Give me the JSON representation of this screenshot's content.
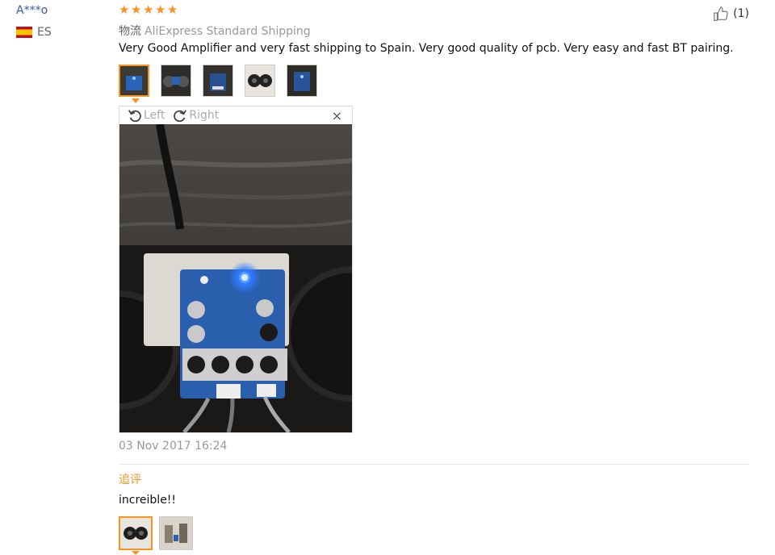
{
  "reviewer": {
    "name": "A***o",
    "country": "ES"
  },
  "review": {
    "rating": 5,
    "helpful_count": "(1)",
    "logistics_label": "物流",
    "logistics_value": "AliExpress Standard Shipping",
    "text": "Very Good Amplifier and very fast shipping to Spain. Very good quality of pcb. Very easy and fast BT pairing.",
    "date": "03 Nov 2017 16:24"
  },
  "viewer": {
    "rotate_left": "Left",
    "rotate_right": "Right",
    "close": "×"
  },
  "followup": {
    "label": "追评",
    "text": "increible!!"
  },
  "colors": {
    "accent": "#f7931e",
    "name_link": "#3a5ba0",
    "muted": "#999999"
  },
  "icons": {
    "rating": "star-icon",
    "helpful": "thumbs-up-icon",
    "rotate_left": "rotate-left-icon",
    "rotate_right": "rotate-right-icon",
    "close": "close-icon",
    "flag": "spain-flag-icon"
  }
}
